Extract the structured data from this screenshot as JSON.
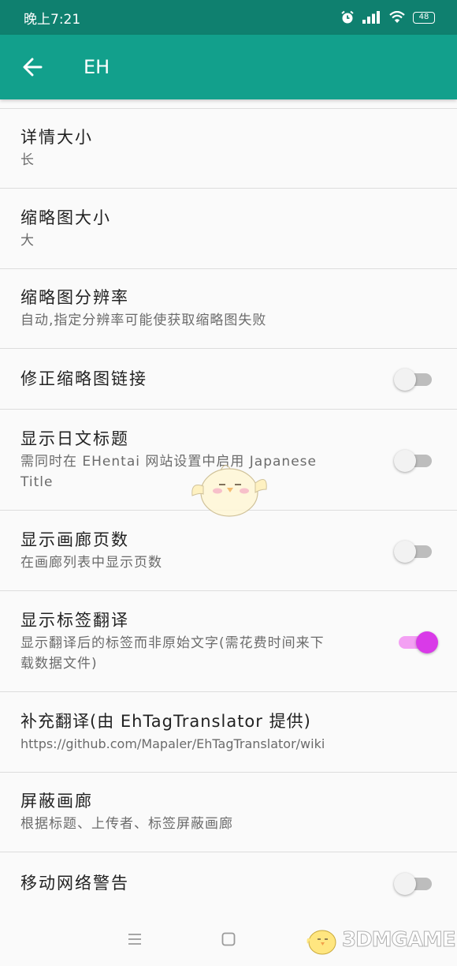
{
  "status_bar": {
    "time": "晚上7:21",
    "battery": "48",
    "icons": [
      "alarm-icon",
      "signal-icon",
      "wifi-icon",
      "battery-icon"
    ]
  },
  "app_bar": {
    "title": "EH",
    "back_icon": "arrow-back-icon"
  },
  "colors": {
    "status_bar": "#0f806f",
    "app_bar": "#12a08c",
    "switch_on_thumb": "#d93ae8",
    "switch_on_track": "#f3a0f3",
    "switch_off_thumb": "#f2f2f2",
    "switch_off_track": "#bdbdbd"
  },
  "settings": [
    {
      "title": "详情大小",
      "subtitle": "长"
    },
    {
      "title": "缩略图大小",
      "subtitle": "大"
    },
    {
      "title": "缩略图分辨率",
      "subtitle": "自动,指定分辨率可能使获取缩略图失败"
    },
    {
      "title": "修正缩略图链接",
      "switch_on": false
    },
    {
      "title": "显示日文标题",
      "subtitle": "需同时在 EHentai 网站设置中启用 Japanese Title",
      "switch_on": false
    },
    {
      "title": "显示画廊页数",
      "subtitle": "在画廊列表中显示页数",
      "switch_on": false
    },
    {
      "title": "显示标签翻译",
      "subtitle": "显示翻译后的标签而非原始文字(需花费时间来下载数据文件)",
      "switch_on": true
    },
    {
      "title": "补充翻译(由 EhTagTranslator 提供)",
      "subtitle": "https://github.com/Mapaler/EhTagTranslator/wiki"
    },
    {
      "title": "屏蔽画廊",
      "subtitle": "根据标题、上传者、标签屏蔽画廊"
    },
    {
      "title": "移动网络警告",
      "switch_on": false
    }
  ],
  "nav_bar": {
    "icons": [
      "menu-icon",
      "home-icon"
    ]
  },
  "watermark": {
    "text": "3DMGAME"
  }
}
